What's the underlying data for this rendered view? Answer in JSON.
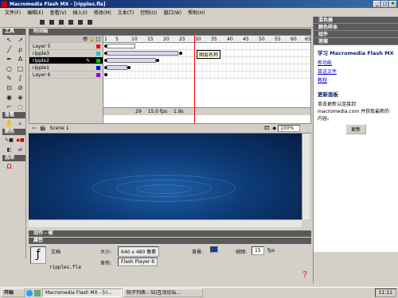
{
  "window": {
    "title": "Macromedia Flash MX - [ripples.fla]"
  },
  "menu": [
    "文件(F)",
    "编辑(E)",
    "查看(V)",
    "插入(I)",
    "修改(M)",
    "文本(T)",
    "控制(O)",
    "窗口(W)",
    "帮助(H)"
  ],
  "tools": {
    "header": "工具",
    "view_header": "查看",
    "colors_header": "颜色",
    "options_header": "选项",
    "icons": [
      "arrow-icon",
      "subselect-icon",
      "line-icon",
      "lasso-icon",
      "pen-icon",
      "text-icon",
      "oval-icon",
      "rect-icon",
      "pencil-icon",
      "brush-icon",
      "free-transform-icon",
      "fill-transform-icon",
      "ink-bottle-icon",
      "paint-bucket-icon",
      "eyedropper-icon",
      "eraser-icon"
    ]
  },
  "timeline": {
    "header": "时间轴",
    "layers": [
      {
        "name": "Layer 5",
        "color": "#ff0000"
      },
      {
        "name": "ripple3",
        "color": "#00cccc"
      },
      {
        "name": "ripple2",
        "color": "#00cc00",
        "selected": true
      },
      {
        "name": "ripple1",
        "color": "#0000ff"
      },
      {
        "name": "Layer 6",
        "color": "#9900cc"
      }
    ],
    "ruler": [
      "1",
      "5",
      "10",
      "15",
      "20",
      "25",
      "30",
      "35",
      "40",
      "45",
      "50",
      "55",
      "60",
      "65"
    ],
    "playhead_tooltip": "图层名称",
    "status_frame": "29",
    "status_fps": "15.0 fps",
    "status_time": "1.9s"
  },
  "scene": {
    "label": "Scene 1",
    "zoom": "100%"
  },
  "actions_panel": {
    "title": "动作 - 帧"
  },
  "properties": {
    "title": "属性",
    "doc_label": "文档",
    "doc_name": "ripples.fla",
    "size_label": "大小:",
    "size_value": "640 x 480 像素",
    "publish_label": "发布:",
    "publish_value": "Flash Player 6",
    "bg_label": "背景:",
    "bg_color": "#1040a0",
    "fps_label": "帧频:",
    "fps_value": "15",
    "fps_unit": "fps"
  },
  "right_panel": {
    "sections": [
      "混色器",
      "颜色样本",
      "组件",
      "答案"
    ],
    "help_title": "学习 Macromedia Flash MX",
    "links": [
      "新功能",
      "目这文件",
      "教程"
    ],
    "update_title": "更新面板",
    "update_text": "单击更新以连接到 macromedia.com 并获取最新的内容。",
    "update_button": "更新"
  },
  "taskbar": {
    "start": "开始",
    "tasks": [
      "Macromedia Flash MX - [ri...",
      "帖子列表 - 5D互动论坛..."
    ],
    "clock": "11:11"
  }
}
